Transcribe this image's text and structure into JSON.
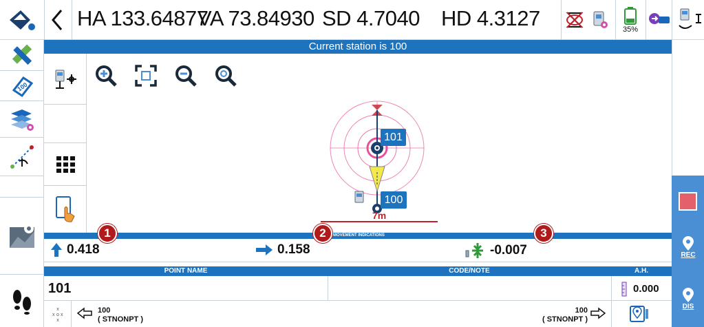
{
  "topbar": {
    "back": "<",
    "ha": "HA 133.64877",
    "va": "VA 73.84930",
    "sd": "SD 4.7040",
    "hd": "HD 4.3127",
    "battery": "35%"
  },
  "station_banner": "Current station is 100",
  "plot": {
    "target_label": "101",
    "station_label": "100",
    "scale_label": "7m"
  },
  "movement": {
    "title": "MOVEMENT INDICATIONS",
    "values": [
      "0.418",
      "0.158",
      "-0.007"
    ],
    "badges": [
      "1",
      "2",
      "3"
    ]
  },
  "table": {
    "headers": [
      "POINT NAME",
      "CODE/NOTE",
      "A.H."
    ],
    "row": {
      "point": "101",
      "code": "",
      "ah": "0.000"
    }
  },
  "nav": {
    "prev_name": "100",
    "prev_type": "( STNONPT )",
    "next_name": "100",
    "next_type": "( STNONPT )"
  },
  "right": {
    "rec": "REC",
    "dis": "DIS"
  },
  "colors": {
    "accent": "#1e73be",
    "badge": "#b11a1a",
    "target": "#e8509a"
  }
}
